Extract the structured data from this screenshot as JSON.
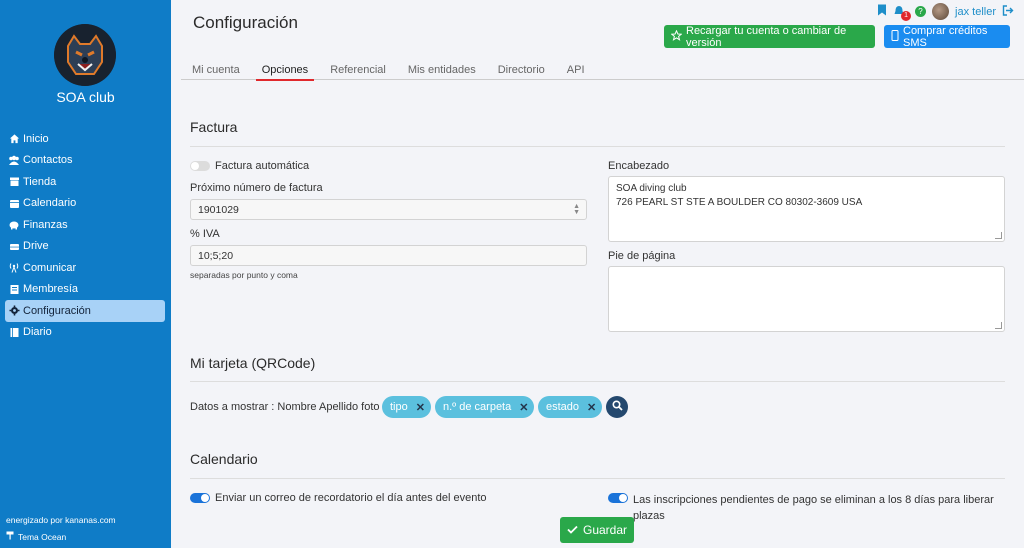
{
  "sidebar": {
    "club_name": "SOA club",
    "items": [
      {
        "label": "Inicio",
        "icon": "home-icon"
      },
      {
        "label": "Contactos",
        "icon": "users-icon"
      },
      {
        "label": "Tienda",
        "icon": "store-icon"
      },
      {
        "label": "Calendario",
        "icon": "calendar-icon"
      },
      {
        "label": "Finanzas",
        "icon": "piggy-bank-icon"
      },
      {
        "label": "Drive",
        "icon": "drive-icon"
      },
      {
        "label": "Comunicar",
        "icon": "broadcast-icon"
      },
      {
        "label": "Membresía",
        "icon": "membership-icon"
      },
      {
        "label": "Configuración",
        "icon": "gear-icon",
        "active": true
      },
      {
        "label": "Diario",
        "icon": "journal-icon"
      }
    ],
    "powered_by": "energizado por kananas.com",
    "theme": "Tema Ocean"
  },
  "header": {
    "title": "Configuración",
    "user_name": "jax teller",
    "notification_count": "1",
    "help_label": "?",
    "recharge_button": "Recargar tu cuenta o cambiar de versión",
    "sms_button": "Comprar créditos SMS"
  },
  "tabs": [
    "Mi cuenta",
    "Opciones",
    "Referencial",
    "Mis entidades",
    "Directorio",
    "API"
  ],
  "factura": {
    "title": "Factura",
    "auto_invoice_label": "Factura automática",
    "next_number_label": "Próximo número de factura",
    "next_number_value": "1901029",
    "iva_label": "% IVA",
    "iva_value": "10;5;20",
    "iva_hint": "separadas por punto y coma",
    "header_label": "Encabezado",
    "header_line1": "SOA diving club",
    "header_line2": "726 PEARL ST STE A BOULDER CO 80302-3609 USA",
    "footer_label": "Pie de página"
  },
  "tarjeta": {
    "title": "Mi tarjeta (QRCode)",
    "display_label": "Datos a mostrar : Nombre Apellido foto",
    "chips": [
      "tipo",
      "n.º de carpeta",
      "estado"
    ]
  },
  "calendario": {
    "title": "Calendario",
    "reminder_label": "Enviar un correo de recordatorio el día antes del evento",
    "pending_label": "Las inscripciones pendientes de pago se eliminan a los 8 días para liberar plazas"
  },
  "save_button": "Guardar",
  "colors": {
    "sidebar": "#0f7cc7",
    "active_nav": "#a8d2f7",
    "green": "#2aa84a",
    "blue": "#1a8cf0",
    "chip": "#5bc0de",
    "tab_underline": "#e0282c"
  }
}
